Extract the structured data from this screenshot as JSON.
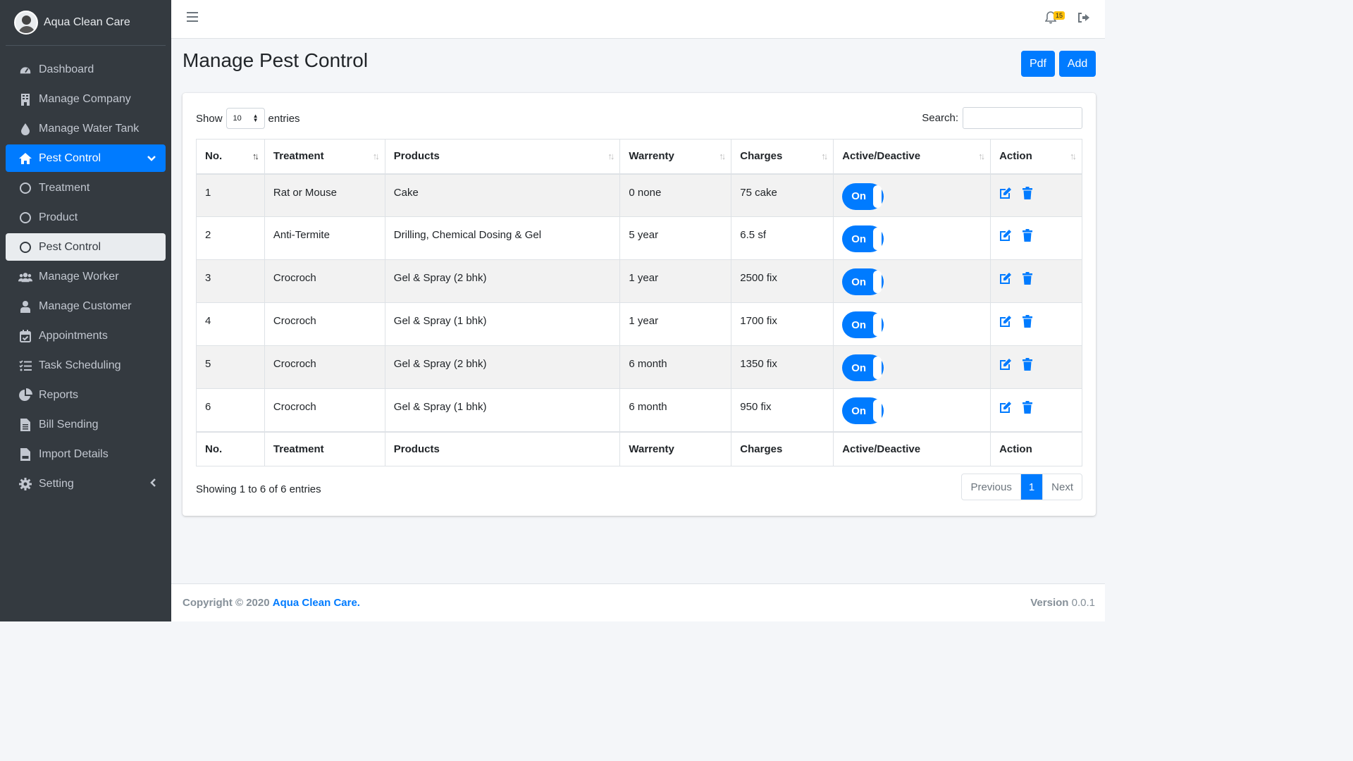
{
  "brand": {
    "name": "Aqua Clean Care"
  },
  "sidebar": {
    "items": [
      {
        "label": "Dashboard",
        "icon": "dashboard-icon"
      },
      {
        "label": "Manage Company",
        "icon": "building-icon"
      },
      {
        "label": "Manage Water Tank",
        "icon": "water-drop-icon"
      },
      {
        "label": "Pest Control",
        "icon": "home-icon"
      },
      {
        "label": "Treatment",
        "icon": "circle-icon"
      },
      {
        "label": "Product",
        "icon": "circle-icon"
      },
      {
        "label": "Pest Control",
        "icon": "circle-icon"
      },
      {
        "label": "Manage Worker",
        "icon": "users-icon"
      },
      {
        "label": "Manage Customer",
        "icon": "user-icon"
      },
      {
        "label": "Appointments",
        "icon": "calendar-check-icon"
      },
      {
        "label": "Task Scheduling",
        "icon": "tasks-icon"
      },
      {
        "label": "Reports",
        "icon": "pie-chart-icon"
      },
      {
        "label": "Bill Sending",
        "icon": "file-text-icon"
      },
      {
        "label": "Import Details",
        "icon": "file-csv-icon"
      },
      {
        "label": "Setting",
        "icon": "gear-icon"
      }
    ]
  },
  "topbar": {
    "notification_count": "15"
  },
  "page": {
    "title": "Manage Pest Control"
  },
  "buttons": {
    "pdf": "Pdf",
    "add": "Add"
  },
  "table_controls": {
    "show": "Show",
    "entries": "entries",
    "page_size": "10",
    "search_label": "Search:"
  },
  "table": {
    "columns": [
      "No.",
      "Treatment",
      "Products",
      "Warrenty",
      "Charges",
      "Active/Deactive",
      "Action"
    ],
    "rows": [
      {
        "no": "1",
        "treatment": "Rat or Mouse",
        "products": "Cake",
        "warrenty": "0 none",
        "charges": "75 cake",
        "status": "On"
      },
      {
        "no": "2",
        "treatment": "Anti-Termite",
        "products": "Drilling, Chemical Dosing & Gel",
        "warrenty": "5 year",
        "charges": "6.5 sf",
        "status": "On"
      },
      {
        "no": "3",
        "treatment": "Crocroch",
        "products": "Gel & Spray (2 bhk)",
        "warrenty": "1 year",
        "charges": "2500 fix",
        "status": "On"
      },
      {
        "no": "4",
        "treatment": "Crocroch",
        "products": "Gel & Spray (1 bhk)",
        "warrenty": "1 year",
        "charges": "1700 fix",
        "status": "On"
      },
      {
        "no": "5",
        "treatment": "Crocroch",
        "products": "Gel & Spray (2 bhk)",
        "warrenty": "6 month",
        "charges": "1350 fix",
        "status": "On"
      },
      {
        "no": "6",
        "treatment": "Crocroch",
        "products": "Gel & Spray (1 bhk)",
        "warrenty": "6 month",
        "charges": "950 fix",
        "status": "On"
      }
    ]
  },
  "info": "Showing 1 to 6 of 6 entries",
  "pagination": {
    "previous": "Previous",
    "current": "1",
    "next": "Next"
  },
  "footer": {
    "copyright": "Copyright © 2020",
    "company": "Aqua Clean Care.",
    "version_label": "Version",
    "version": "0.0.1"
  },
  "colors": {
    "primary": "#007bff",
    "sidebar_bg": "#343a40",
    "badge": "#ffc107"
  }
}
